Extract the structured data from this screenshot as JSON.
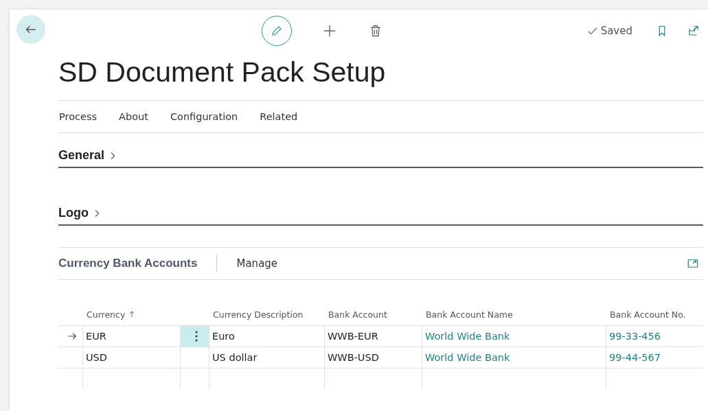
{
  "title": "SD Document Pack Setup",
  "status": "Saved",
  "actions": [
    "Process",
    "About",
    "Configuration",
    "Related"
  ],
  "sections": [
    {
      "title": "General",
      "expanded": false
    },
    {
      "title": "Logo",
      "expanded": false
    }
  ],
  "part": {
    "title": "Currency Bank Accounts",
    "actions": [
      "Manage"
    ],
    "columns": [
      {
        "label": "Currency",
        "sorted": true
      },
      {
        "label": "Currency Description",
        "sorted": false
      },
      {
        "label": "Bank Account",
        "sorted": false
      },
      {
        "label": "Bank Account Name",
        "sorted": false
      },
      {
        "label": "Bank Account No.",
        "sorted": false
      }
    ],
    "rows": [
      {
        "selected": true,
        "currency": "EUR",
        "description": "Euro",
        "bank_account": "WWB-EUR",
        "bank_account_name": "World Wide Bank",
        "bank_account_no": "99-33-456"
      },
      {
        "selected": false,
        "currency": "USD",
        "description": "US dollar",
        "bank_account": "WWB-USD",
        "bank_account_name": "World Wide Bank",
        "bank_account_no": "99-44-567"
      }
    ]
  }
}
